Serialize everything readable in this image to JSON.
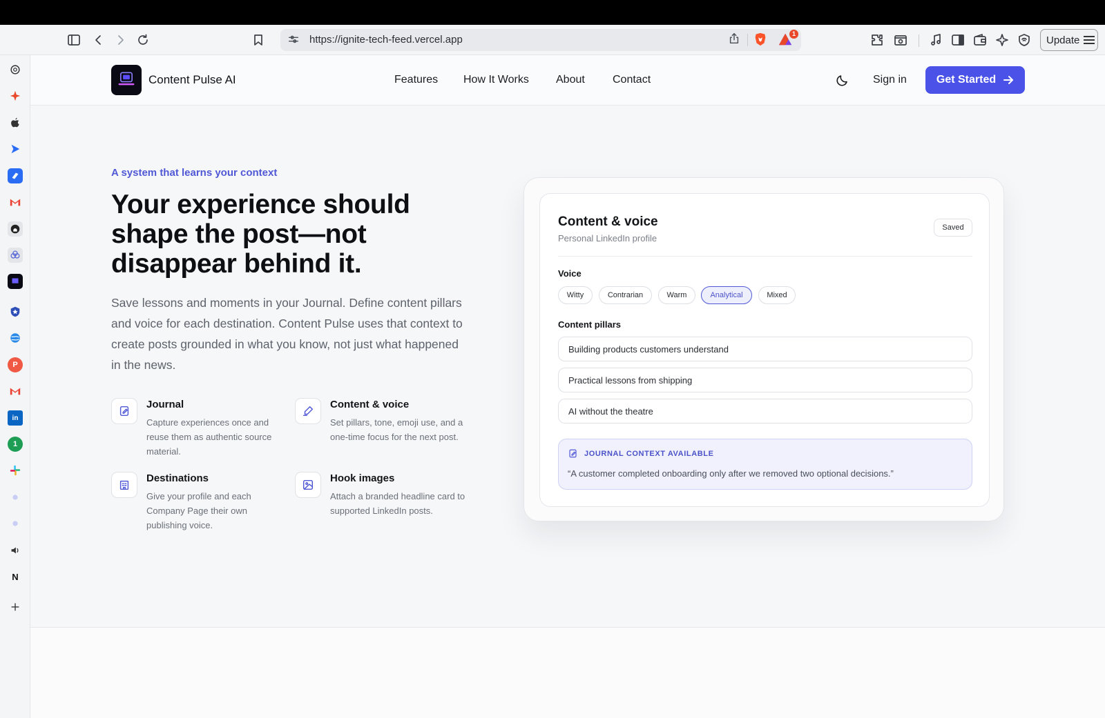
{
  "browser": {
    "url": "https://ignite-tech-feed.vercel.app",
    "rewards_count": "1",
    "update_label": "Update"
  },
  "site": {
    "brand": "Content Pulse AI",
    "nav": [
      {
        "label": "Features"
      },
      {
        "label": "How It Works"
      },
      {
        "label": "About"
      },
      {
        "label": "Contact"
      }
    ],
    "signin_label": "Sign in",
    "cta_label": "Get Started"
  },
  "hero": {
    "eyebrow": "A system that learns your context",
    "title": "Your experience should shape the post—not disappear behind it.",
    "description": "Save lessons and moments in your Journal. Define content pillars and voice for each destination. Content Pulse uses that context to create posts grounded in what you know, not just what happened in the news."
  },
  "features": [
    {
      "title": "Journal",
      "description": "Capture experiences once and reuse them as authentic source material.",
      "icon": "journal-icon"
    },
    {
      "title": "Content & voice",
      "description": "Set pillars, tone, emoji use, and a one-time focus for the next post.",
      "icon": "pen-icon"
    },
    {
      "title": "Destinations",
      "description": "Give your profile and each Company Page their own publishing voice.",
      "icon": "building-icon"
    },
    {
      "title": "Hook images",
      "description": "Attach a branded headline card to supported LinkedIn posts.",
      "icon": "image-icon"
    }
  ],
  "card": {
    "title": "Content & voice",
    "subtitle": "Personal LinkedIn profile",
    "status": "Saved",
    "voice_label": "Voice",
    "voices": [
      {
        "label": "Witty",
        "active": false
      },
      {
        "label": "Contrarian",
        "active": false
      },
      {
        "label": "Warm",
        "active": false
      },
      {
        "label": "Analytical",
        "active": true
      },
      {
        "label": "Mixed",
        "active": false
      }
    ],
    "pillars_label": "Content pillars",
    "pillars": [
      "Building products customers understand",
      "Practical lessons from shipping",
      "AI without the theatre"
    ],
    "journal_label": "JOURNAL CONTEXT AVAILABLE",
    "journal_quote": "“A customer completed onboarding only after we removed two optional decisions.”"
  },
  "colors": {
    "accent": "#4b52e8",
    "accent_text": "#5058d6"
  }
}
